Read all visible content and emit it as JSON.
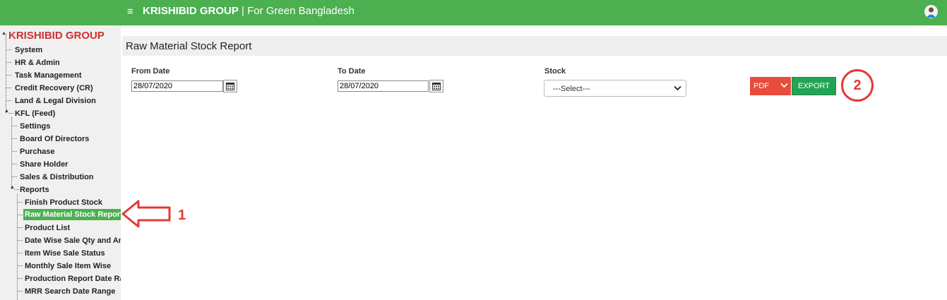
{
  "topbar": {
    "menu_icon": "≡",
    "brand_bold": "KRISHIBID GROUP",
    "brand_rest": " | For Green Bangladesh",
    "avatar_icon": "user-avatar"
  },
  "sidebar": {
    "root": "KRISHIBID GROUP",
    "items": [
      {
        "label": "System"
      },
      {
        "label": "HR & Admin"
      },
      {
        "label": "Task Management"
      },
      {
        "label": "Credit Recovery (CR)"
      },
      {
        "label": "Land & Legal Division"
      },
      {
        "label": "KFL (Feed)"
      },
      {
        "label": "Settings"
      },
      {
        "label": "Board Of Directors"
      },
      {
        "label": "Purchase"
      },
      {
        "label": "Share Holder"
      },
      {
        "label": "Sales & Distribution"
      },
      {
        "label": "Reports"
      },
      {
        "label": "Finish Product Stock"
      },
      {
        "label": "Raw Material Stock Report"
      },
      {
        "label": "Product List"
      },
      {
        "label": "Date Wise Sale Qty and Am"
      },
      {
        "label": "Item Wise Sale Status"
      },
      {
        "label": "Monthly Sale Item Wise"
      },
      {
        "label": "Production Report Date Ra"
      },
      {
        "label": "MRR Search Date Range"
      }
    ]
  },
  "report": {
    "title": "Raw Material Stock Report",
    "from_date_label": "From Date",
    "from_date_value": "28/07/2020",
    "to_date_label": "To Date",
    "to_date_value": "28/07/2020",
    "stock_label": "Stock",
    "stock_selected": "---Select---",
    "format_selected": "PDF",
    "export_label": "EXPORT"
  },
  "annotations": {
    "marker_1": "1",
    "marker_2": "2"
  },
  "colors": {
    "topbar": "#4caf50",
    "active_item": "#4caf50",
    "root_text": "#d32f2f",
    "pdf_button": "#e74c3c",
    "export_button": "#23a455",
    "annotation": "#e53935"
  }
}
